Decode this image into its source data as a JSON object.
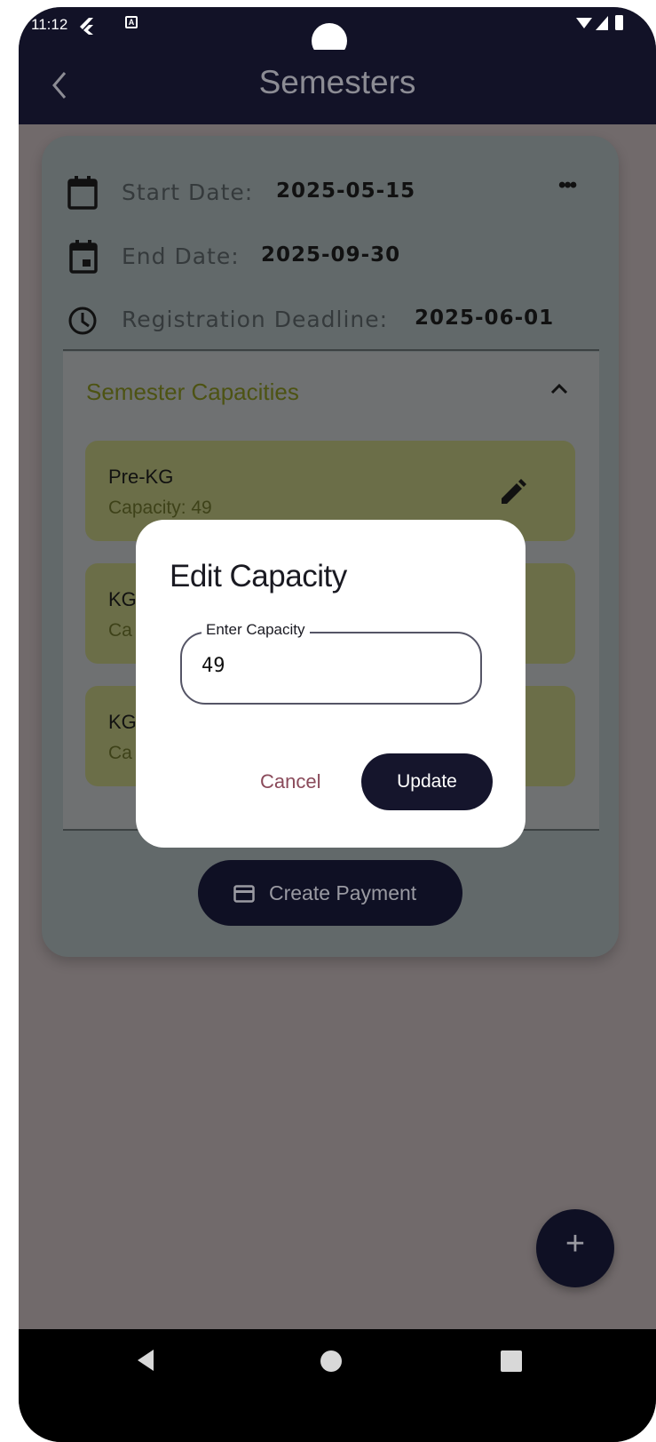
{
  "status_bar": {
    "time": "11:12",
    "badge": "A"
  },
  "app_bar": {
    "title": "Semesters"
  },
  "semester": {
    "start_label": "Start Date:",
    "start_value": "2025-05-15",
    "end_label": "End Date:",
    "end_value": "2025-09-30",
    "deadline_label": "Registration Deadline:",
    "deadline_value": "2025-06-01",
    "more_label": "•••"
  },
  "capacities": {
    "title": "Semester Capacities",
    "items": [
      {
        "name": "Pre-KG",
        "capacity": "Capacity: 49"
      },
      {
        "name": "KG",
        "capacity": "Ca"
      },
      {
        "name": "KG",
        "capacity": "Ca"
      }
    ]
  },
  "create_payment": {
    "label": "Create Payment"
  },
  "dialog": {
    "title": "Edit Capacity",
    "field_label": "Enter Capacity",
    "field_value": "49",
    "cancel_label": "Cancel",
    "update_label": "Update"
  },
  "fab": {
    "label": "+"
  },
  "colors": {
    "dark_navy": "#121227",
    "card_bg": "#62696a",
    "capacity_item": "#6b6e48",
    "section_title": "#4d5313",
    "cancel_text": "#8a4a5a"
  }
}
